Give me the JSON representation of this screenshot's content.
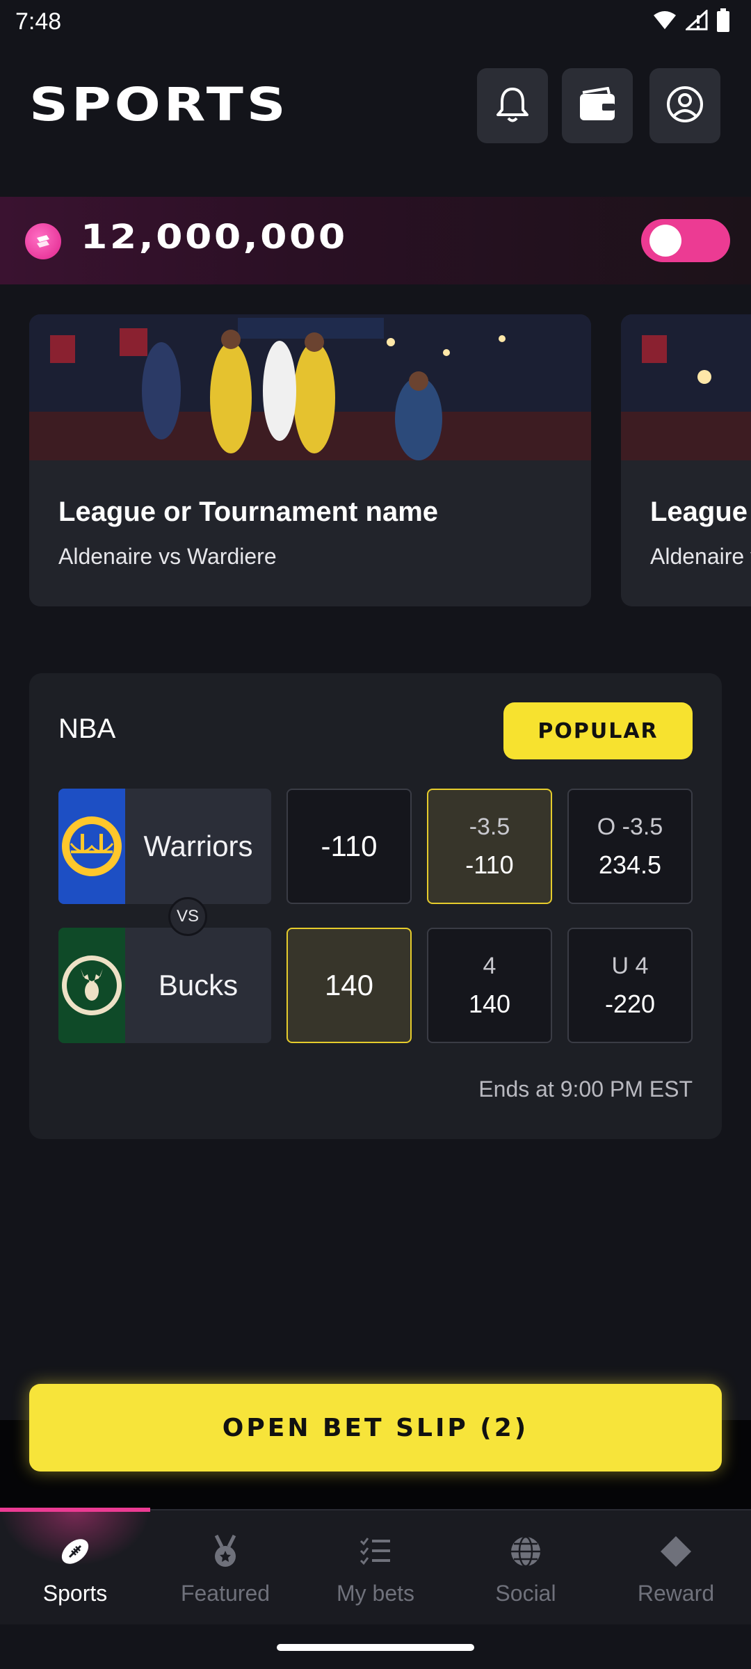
{
  "status_bar": {
    "time": "7:48"
  },
  "header": {
    "title": "SPORTS",
    "icons": [
      "bell-icon",
      "wallet-icon",
      "account-icon"
    ]
  },
  "balance": {
    "amount": "12,000,000",
    "coin_icon": "coin-icon",
    "toggle_on": true
  },
  "carousel": {
    "cards": [
      {
        "title": "League or Tournament name",
        "subtitle": "Aldenaire vs Wardiere"
      },
      {
        "title": "League or Tournament name",
        "subtitle": "Aldenaire vs Wardiere"
      }
    ]
  },
  "match": {
    "league": "NBA",
    "badge": "POPULAR",
    "vs": "VS",
    "teams": [
      {
        "name": "Warriors",
        "moneyline": "-110",
        "spread_line": "-3.5",
        "spread_odds": "-110",
        "total_line": "O -3.5",
        "total_odds": "234.5"
      },
      {
        "name": "Bucks",
        "moneyline": "140",
        "spread_line": "4",
        "spread_odds": "140",
        "total_line": "U 4",
        "total_odds": "-220"
      }
    ],
    "ends": "Ends at 9:00 PM EST"
  },
  "bet_slip": {
    "label": "OPEN BET SLIP (2)"
  },
  "nav": {
    "items": [
      {
        "label": "Sports",
        "icon": "football-icon"
      },
      {
        "label": "Featured",
        "icon": "medal-icon"
      },
      {
        "label": "My bets",
        "icon": "checklist-icon"
      },
      {
        "label": "Social",
        "icon": "globe-icon"
      },
      {
        "label": "Reward",
        "icon": "diamond-icon"
      }
    ]
  },
  "colors": {
    "accent_pink": "#ec3b93",
    "accent_yellow": "#f7e22f",
    "background": "#13141a"
  }
}
